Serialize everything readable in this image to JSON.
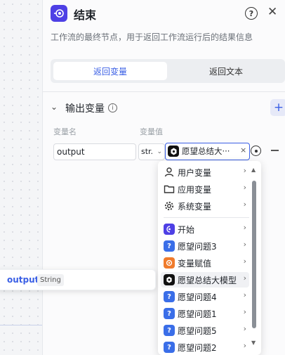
{
  "header": {
    "title": "结束",
    "help": "?",
    "close": "✕"
  },
  "description": "工作流的最终节点，用于返回工作流运行后的结果信息",
  "tabs": [
    {
      "label": "返回变量",
      "active": true
    },
    {
      "label": "返回文本",
      "active": false
    }
  ],
  "section": {
    "title": "输出变量",
    "add": "+"
  },
  "columns": {
    "name": "变量名",
    "value": "变量值"
  },
  "row": {
    "name_value": "output",
    "type_value": "str.",
    "ref_value": "愿望总结大···",
    "clear": "×"
  },
  "dropdown": {
    "group_items": [
      {
        "label": "用户变量",
        "icon": "user-icon"
      },
      {
        "label": "应用变量",
        "icon": "folder-icon"
      },
      {
        "label": "系统变量",
        "icon": "gear-icon"
      }
    ],
    "node_items": [
      {
        "label": "开始",
        "icon": "start-icon",
        "color": "#4e40e5"
      },
      {
        "label": "愿望问题3",
        "icon": "question-icon",
        "color": "#3a6ee8"
      },
      {
        "label": "变量赋值",
        "icon": "assign-icon",
        "color": "#f07b2c"
      },
      {
        "label": "愿望总结大模型",
        "icon": "llm-icon",
        "color": "#111111",
        "selected": true
      },
      {
        "label": "愿望问题4",
        "icon": "question-icon",
        "color": "#3a6ee8"
      },
      {
        "label": "愿望问题1",
        "icon": "question-icon",
        "color": "#3a6ee8"
      },
      {
        "label": "愿望问题5",
        "icon": "question-icon",
        "color": "#3a6ee8"
      },
      {
        "label": "愿望问题2",
        "icon": "question-icon",
        "color": "#3a6ee8"
      }
    ],
    "arrow": "›"
  },
  "drag_chip": {
    "name": "output",
    "type": "String"
  },
  "colors": {
    "accent": "#3a5fe5",
    "end_node": "#4e40e5"
  }
}
